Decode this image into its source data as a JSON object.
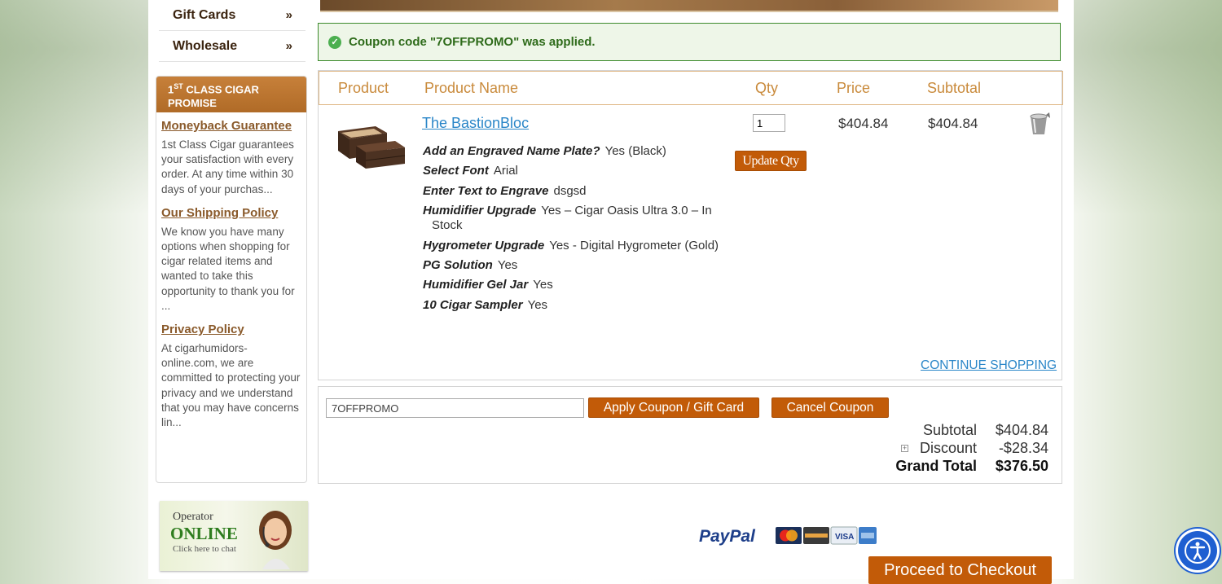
{
  "sidebar": {
    "nav": [
      {
        "label": "Gift Cards",
        "chevron": "»"
      },
      {
        "label": "Wholesale",
        "chevron": "»"
      }
    ],
    "promise": {
      "title_sup_num": "1",
      "title_sup": "ST",
      "title_rest": " CLASS CIGAR PROMISE",
      "sections": [
        {
          "link": "Moneyback Guarantee",
          "text": "1st Class Cigar guarantees your satisfaction with every order.  At any time within 30 days of your purchas..."
        },
        {
          "link": "Our Shipping Policy",
          "text": "We know you have many options when shopping for cigar related items and wanted to take this opportunity to thank you for ..."
        },
        {
          "link": "Privacy Policy",
          "text": "At cigarhumidors-online.com, we are committed to protecting your privacy and we understand that you may have concerns lin..."
        }
      ]
    },
    "operator": {
      "line1": "Operator",
      "line2": "ONLINE",
      "line3": "Click here to chat"
    }
  },
  "message": {
    "icon": "check-circle-icon",
    "text": "Coupon code \"7OFFPROMO\" was applied."
  },
  "cart": {
    "headers": {
      "product": "Product",
      "name": "Product Name",
      "qty": "Qty",
      "price": "Price",
      "subtotal": "Subtotal"
    },
    "item": {
      "name": "The BastionBloc",
      "qty": "1",
      "price": "$404.84",
      "subtotal": "$404.84",
      "options": [
        {
          "label": "Add an Engraved Name Plate?",
          "value": "Yes (Black)"
        },
        {
          "label": "Select Font",
          "value": "Arial"
        },
        {
          "label": "Enter Text to Engrave",
          "value": "dsgsd"
        },
        {
          "label": "Humidifier Upgrade",
          "value": "Yes – Cigar Oasis Ultra 3.0 – In",
          "value2": "Stock"
        },
        {
          "label": "Hygrometer Upgrade",
          "value": "Yes - Digital Hygrometer (Gold)"
        },
        {
          "label": "PG Solution",
          "value": "Yes"
        },
        {
          "label": "Humidifier Gel Jar",
          "value": "Yes"
        },
        {
          "label": "10 Cigar Sampler",
          "value": "Yes"
        }
      ]
    },
    "update_qty": "Update Qty",
    "continue": "CONTINUE SHOPPING"
  },
  "coupon": {
    "value": "7OFFPROMO",
    "apply": "Apply Coupon / Gift Card",
    "cancel": "Cancel Coupon"
  },
  "totals": {
    "subtotal_label": "Subtotal",
    "subtotal": "$404.84",
    "discount_label": "Discount",
    "discount": "-$28.34",
    "grand_label": "Grand Total",
    "grand": "$376.50"
  },
  "payment": {
    "paypal": "PayPal"
  },
  "checkout": "Proceed to Checkout",
  "colors": {
    "accent": "#c25b08",
    "link": "#2a86c8",
    "success": "#3c8a2b",
    "header": "#c98a3b"
  }
}
